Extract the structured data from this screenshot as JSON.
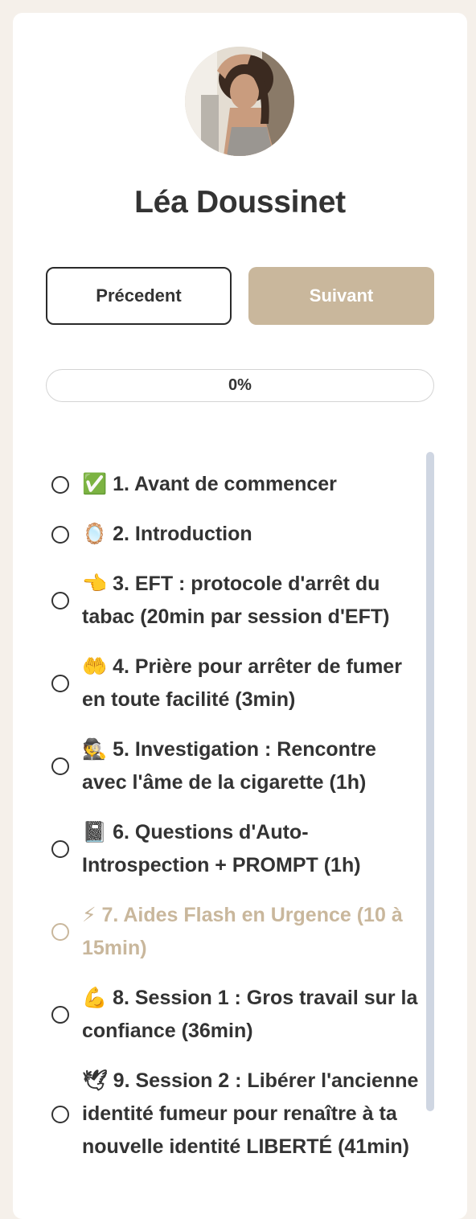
{
  "instructor": {
    "name": "Léa Doussinet"
  },
  "nav": {
    "prev_label": "Précedent",
    "next_label": "Suivant"
  },
  "progress": {
    "label": "0%",
    "value": 0
  },
  "colors": {
    "accent": "#c9b79c",
    "text": "#333333",
    "page_background": "#f5f0ea",
    "scrollbar": "#cfd6e2"
  },
  "lessons": [
    {
      "label": "✅ 1. Avant de commencer",
      "active": false
    },
    {
      "label": "🪞 2. Introduction",
      "active": false
    },
    {
      "label": "👈 3. EFT : protocole d'arrêt du tabac (20min par session d'EFT)",
      "active": false
    },
    {
      "label": "🤲 4. Prière pour arrêter de fumer en toute facilité (3min)",
      "active": false
    },
    {
      "label": "🕵 5. Investigation : Rencontre avec l'âme de la cigarette (1h)",
      "active": false
    },
    {
      "label": "📓 6. Questions d'Auto-Introspection + PROMPT (1h)",
      "active": false
    },
    {
      "label": "⚡ 7. Aides Flash en Urgence (10 à 15min)",
      "active": true
    },
    {
      "label": "💪 8. Session 1 : Gros travail sur la confiance (36min)",
      "active": false
    },
    {
      "label": "🕊 9. Session 2 : Libérer l'ancienne identité fumeur pour renaître à ta nouvelle identité LIBERTÉ (41min)",
      "active": false
    }
  ]
}
